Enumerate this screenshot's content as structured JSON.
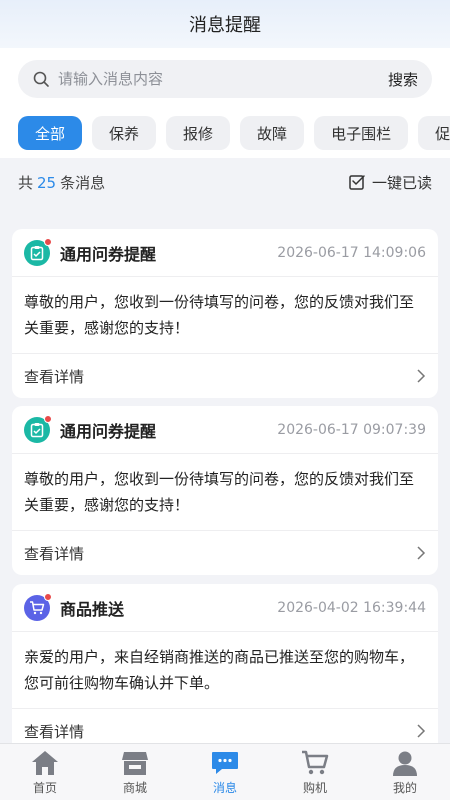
{
  "header": {
    "title": "消息提醒"
  },
  "search": {
    "placeholder": "请输入消息内容",
    "button": "搜索"
  },
  "filters": [
    "全部",
    "保养",
    "报修",
    "故障",
    "电子围栏",
    "促"
  ],
  "summary": {
    "prefix": "共",
    "count": "25",
    "suffix": "条消息",
    "read_all": "一键已读"
  },
  "messages": [
    {
      "title": "通用问券提醒",
      "time": "2026-06-17 14:09:06",
      "body": "尊敬的用户，您收到一份待填写的问卷，您的反馈对我们至关重要，感谢您的支持！",
      "link": "查看详情",
      "icon": "clipboard-icon"
    },
    {
      "title": "通用问券提醒",
      "time": "2026-06-17 09:07:39",
      "body": "尊敬的用户，您收到一份待填写的问卷，您的反馈对我们至关重要，感谢您的支持！",
      "link": "查看详情",
      "icon": "clipboard-icon"
    },
    {
      "title": "商品推送",
      "time": "2026-04-02 16:39:44",
      "body": "亲爱的用户，来自经销商推送的商品已推送至您的购物车，您可前往购物车确认并下单。",
      "link": "查看详情",
      "icon": "cart-icon"
    }
  ],
  "tabs": [
    "首页",
    "商城",
    "消息",
    "购机",
    "我的"
  ],
  "colors": {
    "accent": "#2c8ae8",
    "unread_dot": "#e84a4a",
    "survey_icon": "#1bb8a5",
    "product_icon": "#5b63e6"
  }
}
